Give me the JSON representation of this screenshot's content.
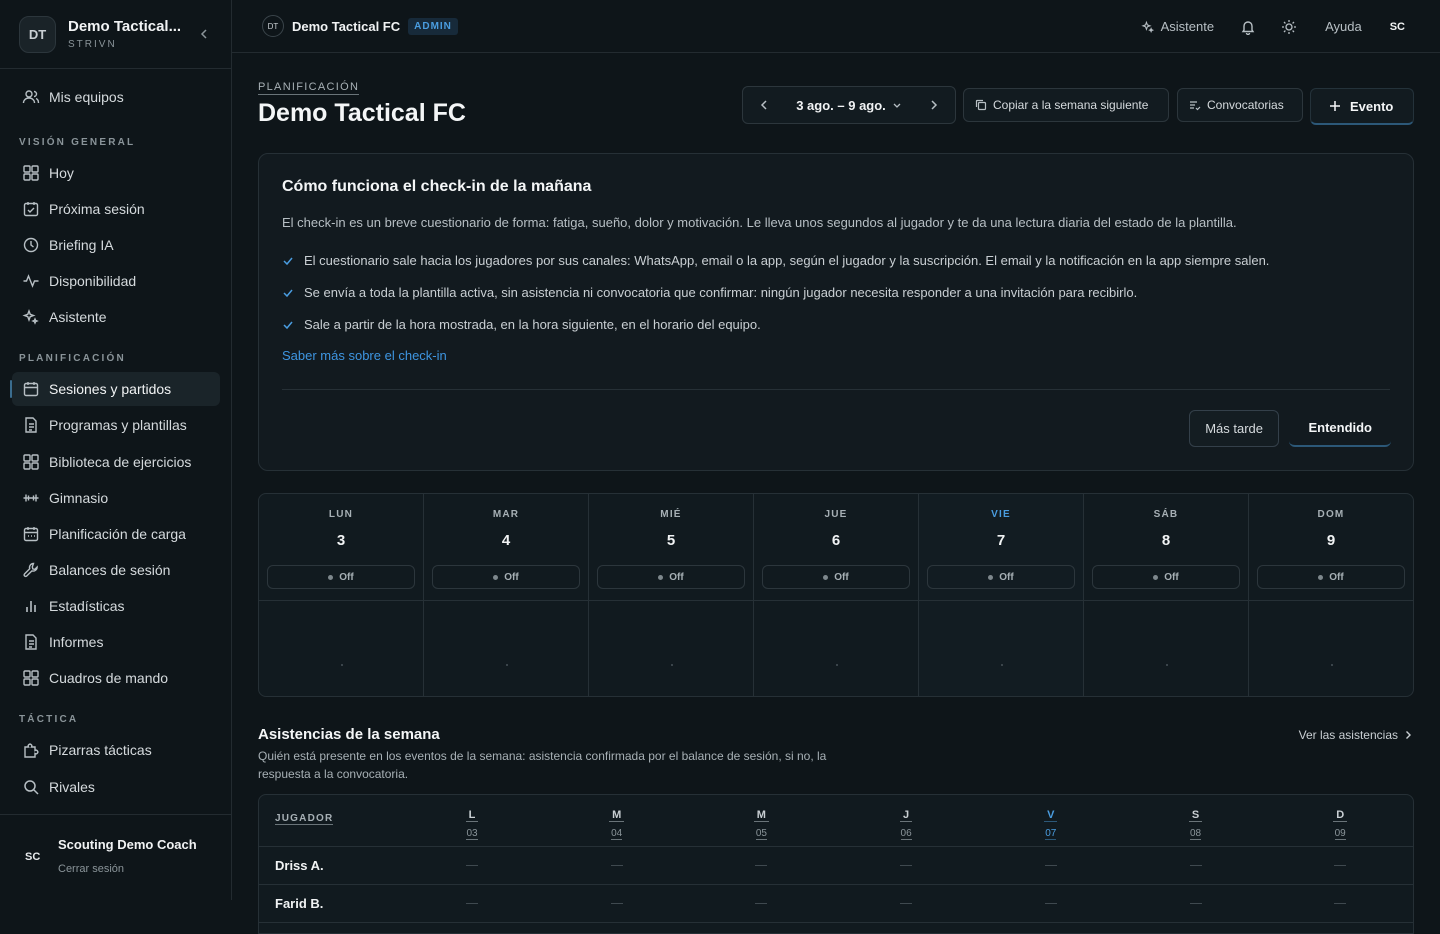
{
  "sidebar": {
    "team": {
      "initials": "DT",
      "name": "Demo Tactical...",
      "sub": "STRIVN"
    },
    "my_teams": "Mis equipos",
    "sections": [
      {
        "label": "VISIÓN GENERAL"
      },
      {
        "label": "PLANIFICACIÓN"
      },
      {
        "label": "TÁCTICA"
      }
    ],
    "items": [
      {
        "label": "Hoy",
        "icon": "grid-icon"
      },
      {
        "label": "Próxima sesión",
        "icon": "calendar-check-icon"
      },
      {
        "label": "Briefing IA",
        "icon": "clock-icon"
      },
      {
        "label": "Disponibilidad",
        "icon": "activity-icon"
      },
      {
        "label": "Asistente",
        "icon": "sparkles-icon"
      },
      {
        "label": "Sesiones y partidos",
        "icon": "calendar-icon"
      },
      {
        "label": "Programas y plantillas",
        "icon": "document-icon"
      },
      {
        "label": "Biblioteca de ejercicios",
        "icon": "grid-icon"
      },
      {
        "label": "Gimnasio",
        "icon": "dumbbell-icon"
      },
      {
        "label": "Planificación de carga",
        "icon": "calendar-icon"
      },
      {
        "label": "Balances de sesión",
        "icon": "wrench-icon"
      },
      {
        "label": "Estadísticas",
        "icon": "bar-chart-icon"
      },
      {
        "label": "Informes",
        "icon": "document-icon"
      },
      {
        "label": "Cuadros de mando",
        "icon": "grid-icon"
      },
      {
        "label": "Pizarras tácticas",
        "icon": "puzzle-icon"
      },
      {
        "label": "Rivales",
        "icon": "search-icon"
      }
    ],
    "user": {
      "initials": "SC",
      "name": "Scouting Demo Coach",
      "logout": "Cerrar sesión"
    }
  },
  "topbar": {
    "initials": "DT",
    "title": "Demo Tactical FC",
    "badge": "ADMIN",
    "assistant": "Asistente",
    "help": "Ayuda",
    "user_initials": "SC"
  },
  "header": {
    "eyebrow": "PLANIFICACIÓN",
    "title": "Demo Tactical FC",
    "week_range": "3 ago. – 9 ago.",
    "copy_label": "Copiar a la semana siguiente",
    "calls_label": "Convocatorias",
    "event_label": "Evento"
  },
  "checkin_card": {
    "title": "Cómo funciona el check-in de la mañana",
    "description": "El check-in es un breve cuestionario de forma: fatiga, sueño, dolor y motivación. Le lleva unos segundos al jugador y te da una lectura diaria del estado de la plantilla.",
    "points": [
      "El cuestionario sale hacia los jugadores por sus canales: WhatsApp, email o la app, según el jugador y la suscripción. El email y la notificación en la app siempre salen.",
      "Se envía a toda la plantilla activa, sin asistencia ni convocatoria que confirmar: ningún jugador necesita responder a una invitación para recibirlo.",
      "Sale a partir de la hora mostrada, en la hora siguiente, en el horario del equipo."
    ],
    "link": "Saber más sobre el check-in",
    "later": "Más tarde",
    "ok": "Entendido"
  },
  "week": {
    "days": [
      {
        "name": "LUN",
        "num": "3",
        "status": "Off"
      },
      {
        "name": "MAR",
        "num": "4",
        "status": "Off"
      },
      {
        "name": "MIÉ",
        "num": "5",
        "status": "Off"
      },
      {
        "name": "JUE",
        "num": "6",
        "status": "Off"
      },
      {
        "name": "VIE",
        "num": "7",
        "status": "Off",
        "today": true
      },
      {
        "name": "SÁB",
        "num": "8",
        "status": "Off"
      },
      {
        "name": "DOM",
        "num": "9",
        "status": "Off"
      }
    ]
  },
  "attendance": {
    "title": "Asistencias de la semana",
    "description": "Quién está presente en los eventos de la semana: asistencia confirmada por el balance de sesión, si no, la respuesta a la convocatoria.",
    "link": "Ver las asistencias",
    "player_header": "JUGADOR",
    "days": [
      {
        "letter": "L",
        "num": "03"
      },
      {
        "letter": "M",
        "num": "04"
      },
      {
        "letter": "M",
        "num": "05"
      },
      {
        "letter": "J",
        "num": "06"
      },
      {
        "letter": "V",
        "num": "07",
        "today": true
      },
      {
        "letter": "S",
        "num": "08"
      },
      {
        "letter": "D",
        "num": "09"
      }
    ],
    "rows": [
      {
        "name": "Driss A."
      },
      {
        "name": "Farid B."
      }
    ]
  },
  "colors": {
    "accent": "#4a9de0",
    "background": "#0e1519",
    "card": "#121a1f"
  }
}
